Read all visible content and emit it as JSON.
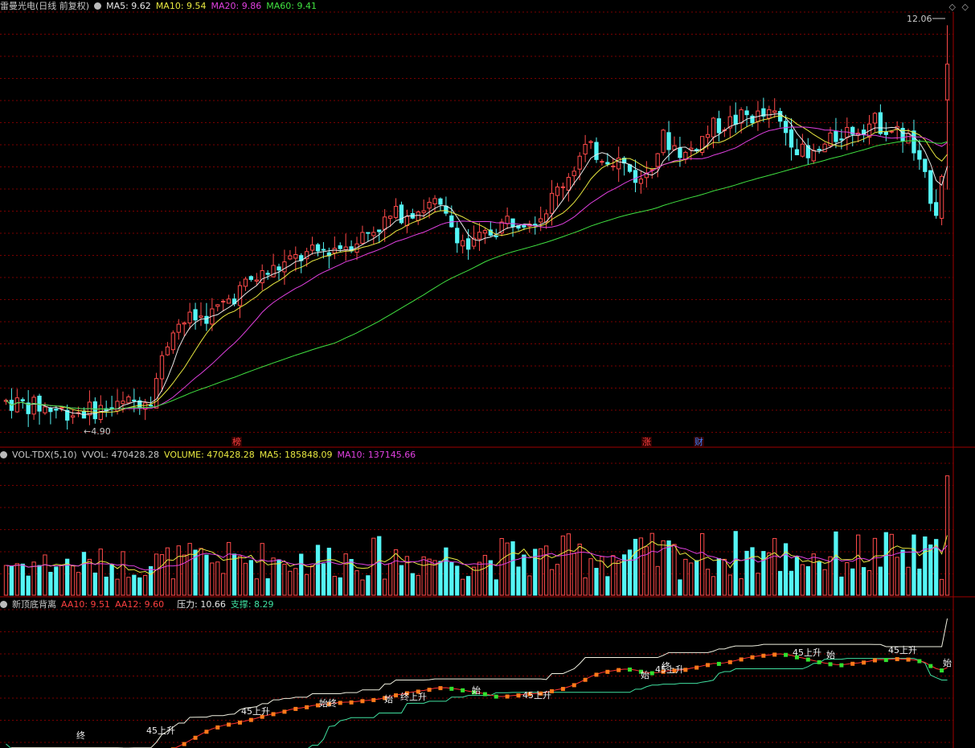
{
  "price_header": {
    "title": "雷曼光电(日线 前复权)",
    "ma5": "MA5: 9.62",
    "ma10": "MA10: 9.54",
    "ma20": "MA20: 9.86",
    "ma60": "MA60: 9.41",
    "icon": "circle-icon"
  },
  "vol_header": {
    "title": "VOL-TDX(5,10)",
    "vvol": "VVOL: 470428.28",
    "volume": "VOLUME: 470428.28",
    "ma5": "MA5: 185848.09",
    "ma10": "MA10: 137145.66"
  },
  "ind_header": {
    "title": "新顶底背离",
    "aa10": "AA10: 9.51",
    "aa12": "AA12: 9.60",
    "pressure": "压力: 10.66",
    "support": "支撑: 8.29"
  },
  "marks": {
    "high": "12.06",
    "low": "4.90",
    "event1": "榜",
    "event2": "涨",
    "event3": "财"
  },
  "signals": [
    "终",
    "45上升",
    "45上升",
    "始终",
    "始",
    "终上升",
    "始",
    "45上升",
    "始",
    "45上升",
    "终",
    "45上升",
    "始",
    "45上升",
    "始",
    "45上升"
  ],
  "colors": {
    "up": "#ff4a4a",
    "down": "#54f5f5",
    "ma5": "#e8e8e8",
    "ma10": "#e8e840",
    "ma20": "#e040e0",
    "ma60": "#40e040",
    "grid": "#7a0000"
  },
  "chart_data": [
    {
      "type": "candlestick",
      "title": "雷曼光电(日线 前复权)",
      "ylim": [
        4.6,
        12.3
      ],
      "high": 12.06,
      "low": 4.9,
      "last_close": 11.35,
      "series": [
        {
          "name": "MA5",
          "last": 9.62
        },
        {
          "name": "MA10",
          "last": 9.54
        },
        {
          "name": "MA20",
          "last": 9.86
        },
        {
          "name": "MA60",
          "last": 9.41
        }
      ]
    },
    {
      "type": "bar",
      "title": "VOL-TDX(5,10)",
      "series": [
        {
          "name": "VOLUME",
          "last": 470428.28
        },
        {
          "name": "MA5",
          "last": 185848.09
        },
        {
          "name": "MA10",
          "last": 137145.66
        }
      ]
    },
    {
      "type": "line",
      "title": "新顶底背离",
      "series": [
        {
          "name": "AA10",
          "last": 9.51
        },
        {
          "name": "AA12",
          "last": 9.6
        },
        {
          "name": "压力",
          "last": 10.66
        },
        {
          "name": "支撑",
          "last": 8.29
        }
      ]
    }
  ]
}
